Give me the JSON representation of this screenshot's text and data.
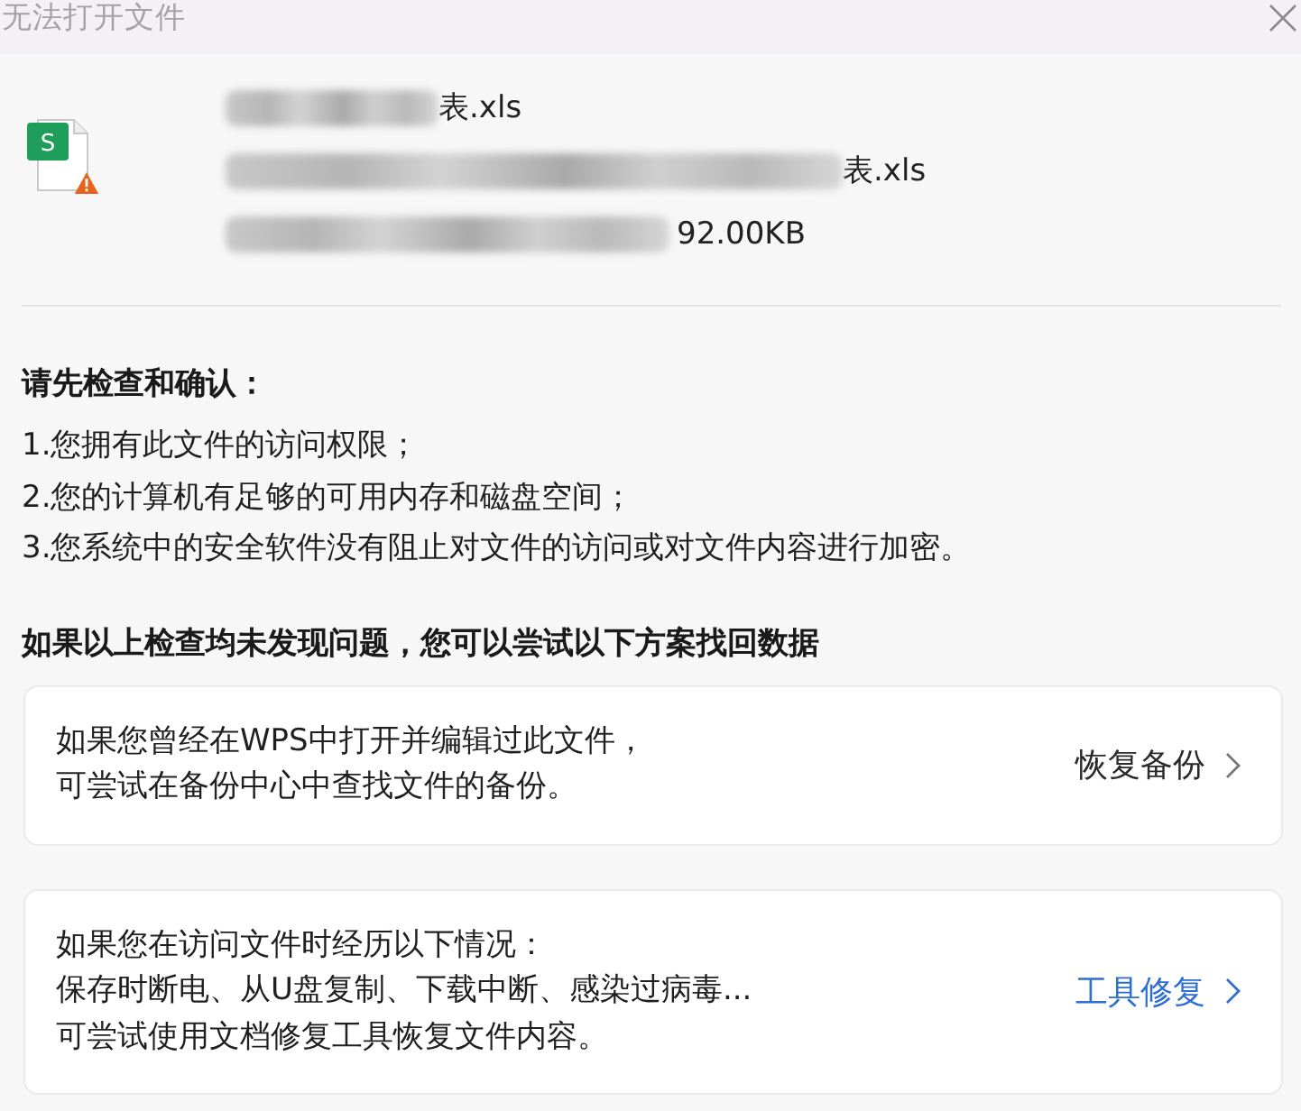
{
  "window": {
    "title": "无法打开文件"
  },
  "file": {
    "icon_letter": "S",
    "warning": true,
    "lines": [
      {
        "kind": "name",
        "text": "表.xls",
        "blurred": true
      },
      {
        "kind": "path",
        "text": "表.xls",
        "blurred": true
      },
      {
        "kind": "size",
        "text": "92.00KB",
        "blurred": true
      }
    ]
  },
  "checklist": {
    "heading": "请先检查和确认：",
    "items": [
      "1.您拥有此文件的访问权限；",
      "2.您的计算机有足够的可用内存和磁盘空间；",
      "3.您系统中的安全软件没有阻止对文件的访问或对文件内容进行加密。"
    ]
  },
  "recovery": {
    "heading": "如果以上检查均未发现问题，您可以尝试以下方案找回数据",
    "options": [
      {
        "lines": [
          "如果您曾经在WPS中打开并编辑过此文件，",
          "可尝试在备份中心中查找文件的备份。"
        ],
        "action": "恢复备份",
        "kind": "default"
      },
      {
        "lines": [
          "如果您在访问文件时经历以下情况：",
          "保存时断电、从U盘复制、下载中断、感染过病毒...",
          "可尝试使用文档修复工具恢复文件内容。"
        ],
        "action": "工具修复",
        "kind": "primary"
      }
    ]
  }
}
